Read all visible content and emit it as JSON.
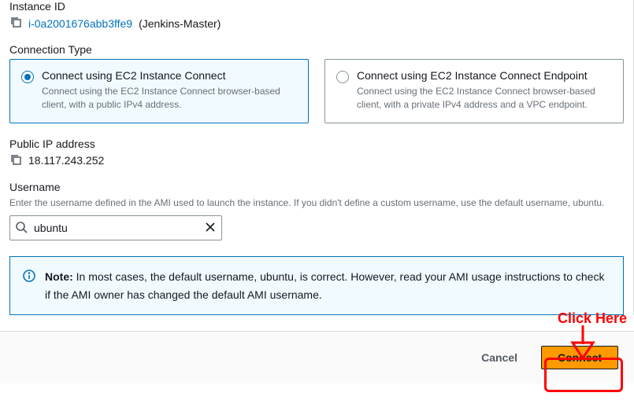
{
  "instance": {
    "label": "Instance ID",
    "id": "i-0a2001676abb3ffe9",
    "name": "(Jenkins-Master)"
  },
  "connection_type": {
    "label": "Connection Type",
    "options": [
      {
        "title": "Connect using EC2 Instance Connect",
        "desc": "Connect using the EC2 Instance Connect browser-based client, with a public IPv4 address."
      },
      {
        "title": "Connect using EC2 Instance Connect Endpoint",
        "desc": "Connect using the EC2 Instance Connect browser-based client, with a private IPv4 address and a VPC endpoint."
      }
    ]
  },
  "public_ip": {
    "label": "Public IP address",
    "value": "18.117.243.252"
  },
  "username": {
    "label": "Username",
    "help": "Enter the username defined in the AMI used to launch the instance. If you didn't define a custom username, use the default username, ubuntu.",
    "value": "ubuntu"
  },
  "note": {
    "prefix": "Note:",
    "text": " In most cases, the default username, ubuntu, is correct. However, read your AMI usage instructions to check if the AMI owner has changed the default AMI username."
  },
  "footer": {
    "cancel": "Cancel",
    "connect": "Connect"
  },
  "annotation": {
    "label": "Click Here"
  }
}
